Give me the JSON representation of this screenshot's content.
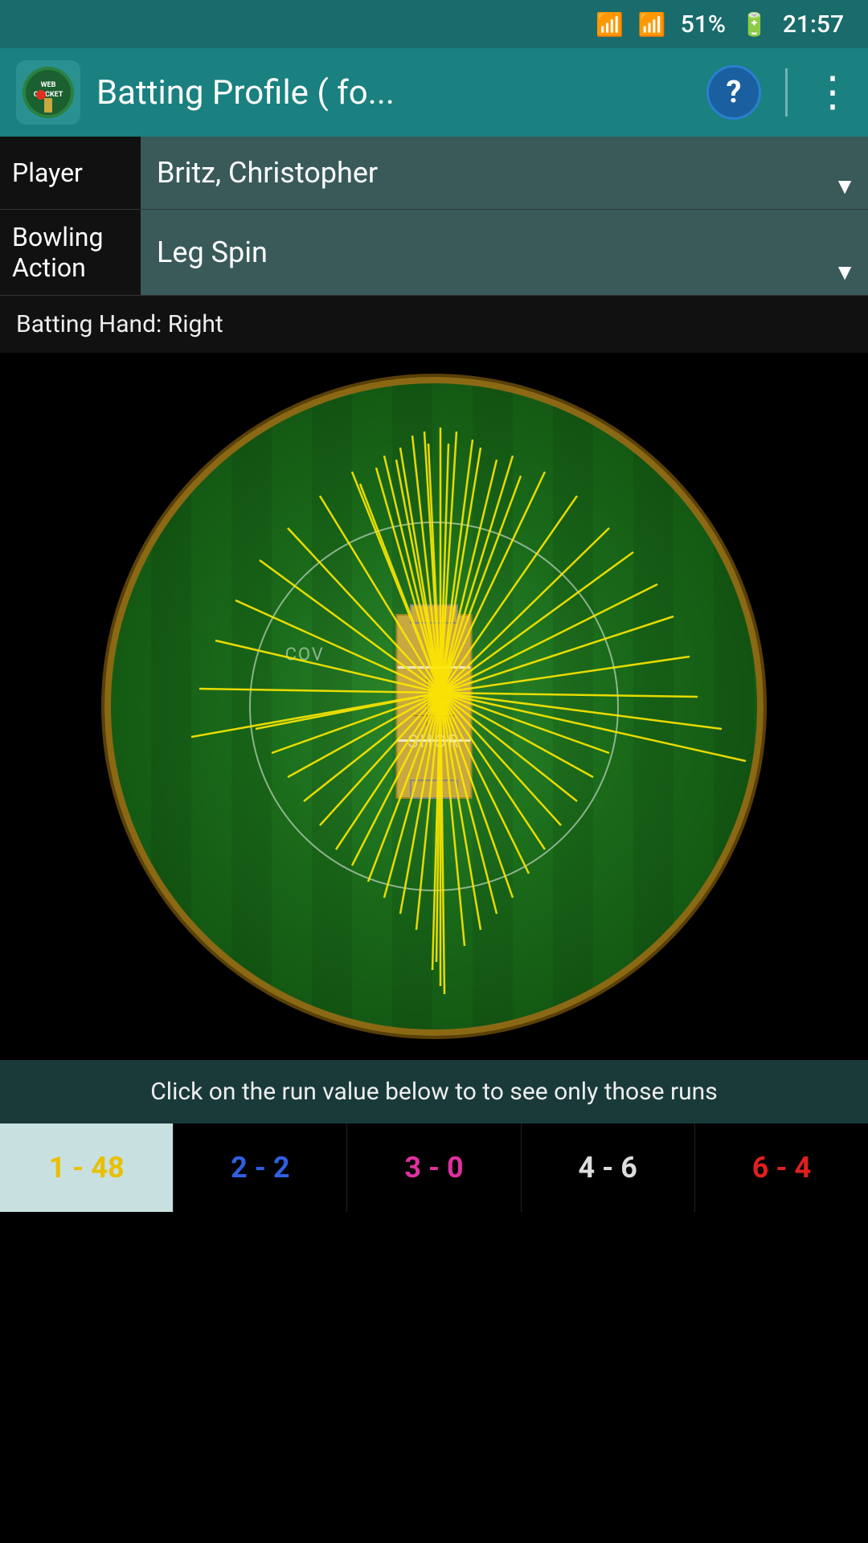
{
  "statusBar": {
    "battery": "51%",
    "time": "21:57"
  },
  "header": {
    "appName": "WEB CRICKET",
    "title": "Batting Profile ( fo...",
    "helpLabel": "?",
    "moreLabel": "⋮"
  },
  "playerField": {
    "label": "Player",
    "value": "Britz, Christopher"
  },
  "bowlingField": {
    "label": "Bowling Action",
    "value": "Leg Spin"
  },
  "battingHand": {
    "text": "Batting Hand: Right"
  },
  "instruction": {
    "text": "Click on the run value below to to see only those runs"
  },
  "scores": [
    {
      "label": "1 - 48",
      "colorClass": "score-yellow",
      "active": true
    },
    {
      "label": "2 - 2",
      "colorClass": "score-blue",
      "active": false
    },
    {
      "label": "3 - 0",
      "colorClass": "score-pink",
      "active": false
    },
    {
      "label": "4 - 6",
      "colorClass": "score-white",
      "active": false
    },
    {
      "label": "6 - 4",
      "colorClass": "score-red",
      "active": false
    }
  ],
  "fieldLabels": {
    "cover": "COV",
    "short": "SHOR"
  }
}
